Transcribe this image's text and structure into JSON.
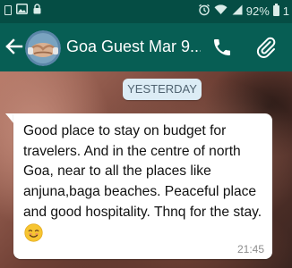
{
  "status_bar": {
    "battery_percent": "92%",
    "notification_count": "1",
    "icons": [
      "document-icon",
      "image-icon",
      "lock-icon",
      "alarm-icon",
      "wifi-icon",
      "signal-icon",
      "battery-icon"
    ]
  },
  "header": {
    "title": "Goa Guest Mar 9...",
    "back_icon": "arrow-back-icon",
    "call_icon": "phone-icon",
    "attach_icon": "paperclip-icon",
    "background_color": "#075e54"
  },
  "chat": {
    "date_label": "YESTERDAY",
    "messages": [
      {
        "text": "Good place to stay on budget for travelers. And in the centre of north Goa, near to all the places like anjuna,baga beaches. Peaceful place and good hospitality. Thnq for the stay.",
        "emoji": "smiling-face-emoji",
        "time": "21:45"
      }
    ]
  }
}
